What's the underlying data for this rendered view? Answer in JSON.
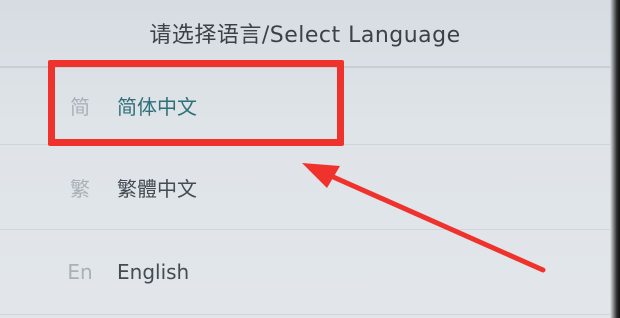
{
  "dialog": {
    "title": "请选择语言/Select Language"
  },
  "languages": [
    {
      "icon": "简",
      "label": "简体中文",
      "selected": true
    },
    {
      "icon": "繁",
      "label": "繁體中文",
      "selected": false
    },
    {
      "icon": "En",
      "label": "English",
      "selected": false
    }
  ],
  "colors": {
    "highlight": "#f0322c",
    "selected_text": "#2f6f79"
  }
}
